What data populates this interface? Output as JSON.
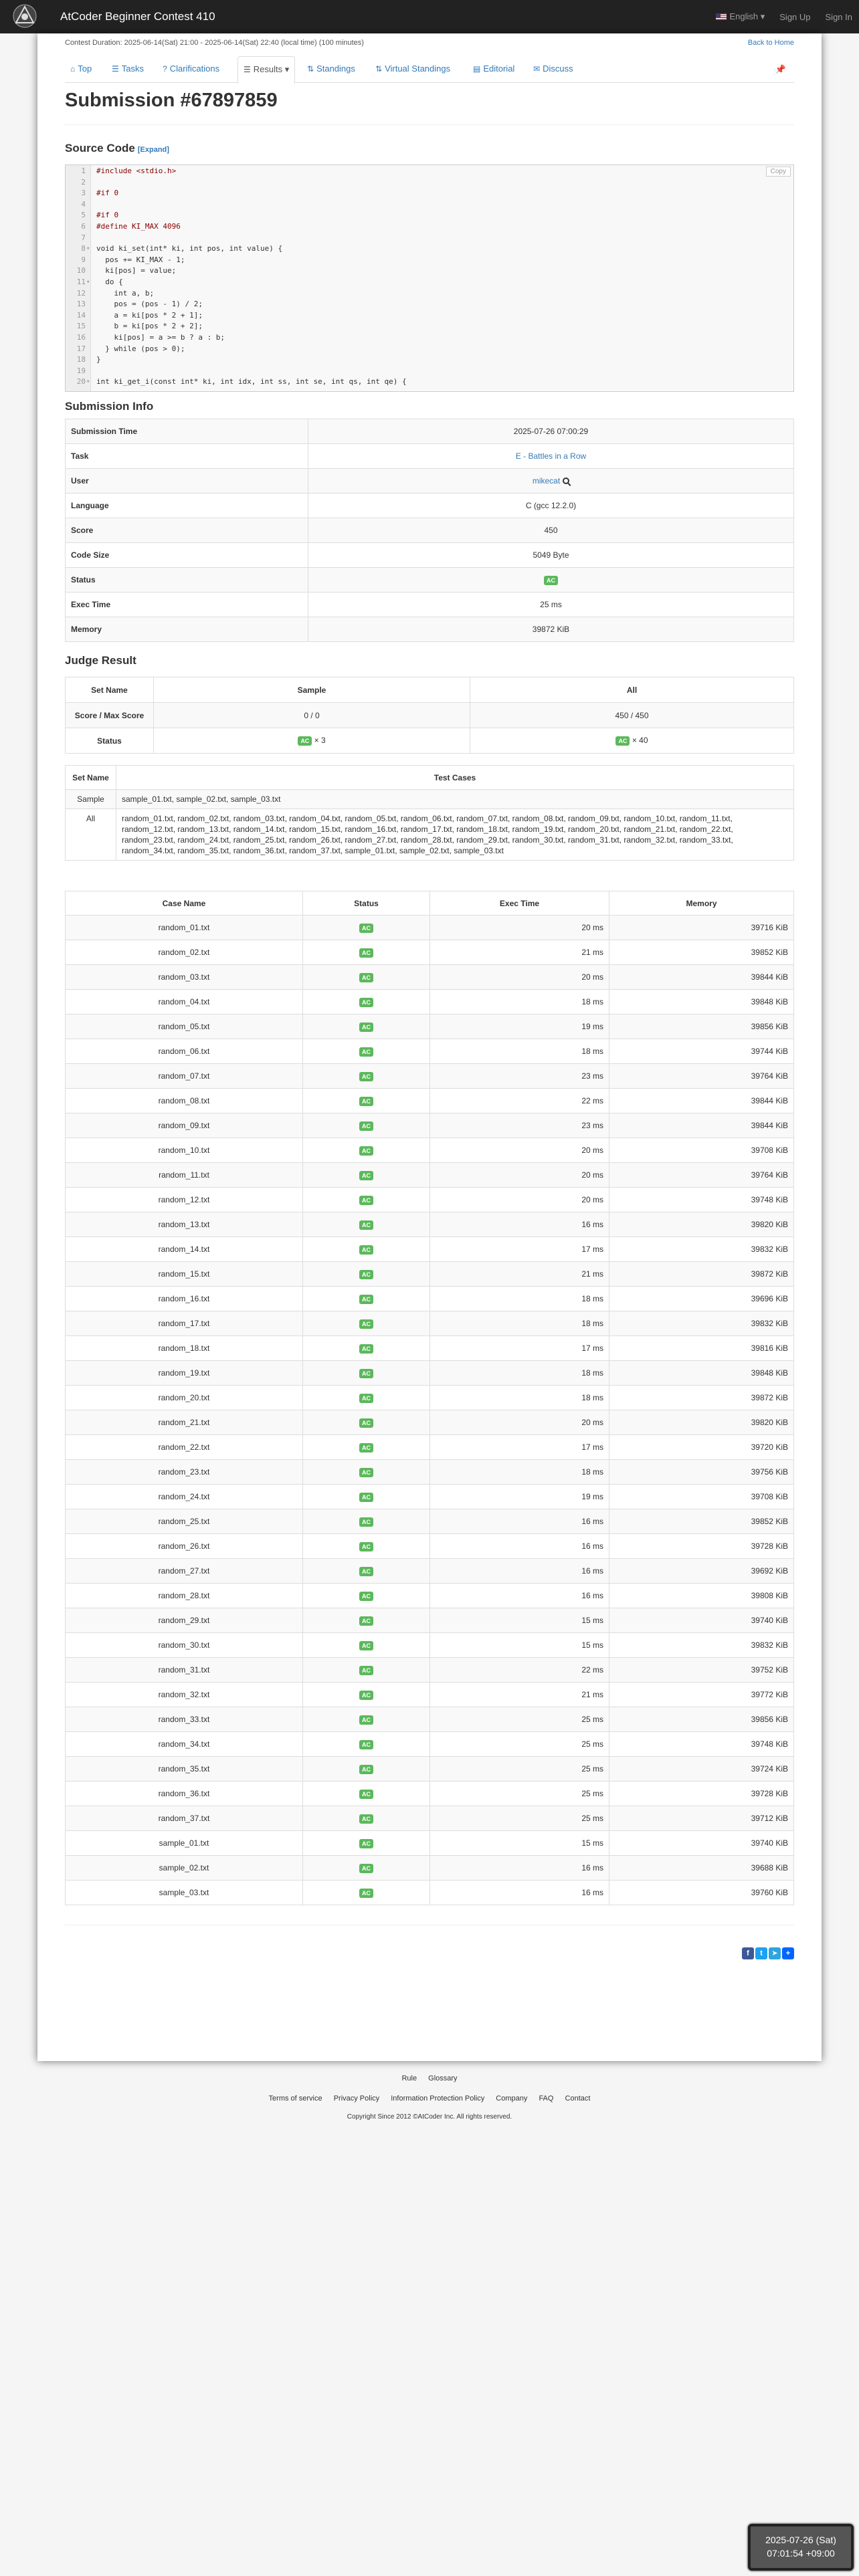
{
  "header": {
    "contest_title": "AtCoder Beginner Contest 410",
    "logo_text": "AtCoder",
    "language": "English",
    "sign_up": "Sign Up",
    "sign_in": "Sign In"
  },
  "contest": {
    "duration": "Contest Duration: 2025-06-14(Sat) 21:00 - 2025-06-14(Sat) 22:40 (local time) (100 minutes)",
    "back_home": "Back to Home"
  },
  "tabs": [
    {
      "label": "Top",
      "icon": "home-icon"
    },
    {
      "label": "Tasks",
      "icon": "list-icon"
    },
    {
      "label": "Clarifications",
      "icon": "question-icon"
    },
    {
      "label": "Results",
      "icon": "list-icon"
    },
    {
      "label": "Standings",
      "icon": "sort-icon"
    },
    {
      "label": "Virtual Standings",
      "icon": "sort-icon"
    },
    {
      "label": "Editorial",
      "icon": "book-icon"
    },
    {
      "label": "Discuss",
      "icon": "comment-icon"
    }
  ],
  "submission": {
    "title": "Submission #67897859",
    "source_heading": "Source Code",
    "expand": "[Expand]",
    "copy": "Copy"
  },
  "code_lines": [
    {
      "n": "1",
      "f": "",
      "t": "#include <stdio.h>"
    },
    {
      "n": "2",
      "f": "",
      "t": ""
    },
    {
      "n": "3",
      "f": "",
      "t": "#if 0"
    },
    {
      "n": "4",
      "f": "",
      "t": ""
    },
    {
      "n": "5",
      "f": "",
      "t": "#if 0"
    },
    {
      "n": "6",
      "f": "",
      "t": "#define KI_MAX 4096"
    },
    {
      "n": "7",
      "f": "",
      "t": ""
    },
    {
      "n": "8",
      "f": "▾",
      "t": "void ki_set(int* ki, int pos, int value) {"
    },
    {
      "n": "9",
      "f": "",
      "t": "  pos += KI_MAX - 1;"
    },
    {
      "n": "10",
      "f": "",
      "t": "  ki[pos] = value;"
    },
    {
      "n": "11",
      "f": "▾",
      "t": "  do {"
    },
    {
      "n": "12",
      "f": "",
      "t": "    int a, b;"
    },
    {
      "n": "13",
      "f": "",
      "t": "    pos = (pos - 1) / 2;"
    },
    {
      "n": "14",
      "f": "",
      "t": "    a = ki[pos * 2 + 1];"
    },
    {
      "n": "15",
      "f": "",
      "t": "    b = ki[pos * 2 + 2];"
    },
    {
      "n": "16",
      "f": "",
      "t": "    ki[pos] = a >= b ? a : b;"
    },
    {
      "n": "17",
      "f": "",
      "t": "  } while (pos > 0);"
    },
    {
      "n": "18",
      "f": "",
      "t": "}"
    },
    {
      "n": "19",
      "f": "",
      "t": ""
    },
    {
      "n": "20",
      "f": "▾",
      "t": "int ki_get_i(const int* ki, int idx, int ss, int se, int qs, int qe) {"
    }
  ],
  "info": {
    "heading": "Submission Info",
    "rows": [
      {
        "label": "Submission Time",
        "value": "2025-07-26 07:00:29"
      },
      {
        "label": "Task",
        "value": "E - Battles in a Row"
      },
      {
        "label": "User",
        "value": "mikecat"
      },
      {
        "label": "Language",
        "value": "C (gcc 12.2.0)"
      },
      {
        "label": "Score",
        "value": "450"
      },
      {
        "label": "Code Size",
        "value": "5049 Byte"
      },
      {
        "label": "Status",
        "value": "AC"
      },
      {
        "label": "Exec Time",
        "value": "25 ms"
      },
      {
        "label": "Memory",
        "value": "39872 KiB"
      }
    ]
  },
  "judge": {
    "heading": "Judge Result",
    "col_set": "Set Name",
    "col_sample": "Sample",
    "col_all": "All",
    "score_label": "Score / Max Score",
    "score_sample": "0 / 0",
    "score_all": "450 / 450",
    "status_label": "Status",
    "status_ac": "AC",
    "sample_count": "× 3",
    "all_count": "× 40"
  },
  "sets": {
    "col_name": "Set Name",
    "col_cases": "Test Cases",
    "rows": [
      {
        "name": "Sample",
        "cases": "sample_01.txt, sample_02.txt, sample_03.txt"
      },
      {
        "name": "All",
        "cases": "random_01.txt, random_02.txt, random_03.txt, random_04.txt, random_05.txt, random_06.txt, random_07.txt, random_08.txt, random_09.txt, random_10.txt, random_11.txt, random_12.txt, random_13.txt, random_14.txt, random_15.txt, random_16.txt, random_17.txt, random_18.txt, random_19.txt, random_20.txt, random_21.txt, random_22.txt, random_23.txt, random_24.txt, random_25.txt, random_26.txt, random_27.txt, random_28.txt, random_29.txt, random_30.txt, random_31.txt, random_32.txt, random_33.txt, random_34.txt, random_35.txt, random_36.txt, random_37.txt, sample_01.txt, sample_02.txt, sample_03.txt"
      }
    ]
  },
  "cases": {
    "headers": [
      "Case Name",
      "Status",
      "Exec Time",
      "Memory"
    ],
    "rows": [
      {
        "name": "random_01.txt",
        "status": "AC",
        "time": "20 ms",
        "mem": "39716 KiB"
      },
      {
        "name": "random_02.txt",
        "status": "AC",
        "time": "21 ms",
        "mem": "39852 KiB"
      },
      {
        "name": "random_03.txt",
        "status": "AC",
        "time": "20 ms",
        "mem": "39844 KiB"
      },
      {
        "name": "random_04.txt",
        "status": "AC",
        "time": "18 ms",
        "mem": "39848 KiB"
      },
      {
        "name": "random_05.txt",
        "status": "AC",
        "time": "19 ms",
        "mem": "39856 KiB"
      },
      {
        "name": "random_06.txt",
        "status": "AC",
        "time": "18 ms",
        "mem": "39744 KiB"
      },
      {
        "name": "random_07.txt",
        "status": "AC",
        "time": "23 ms",
        "mem": "39764 KiB"
      },
      {
        "name": "random_08.txt",
        "status": "AC",
        "time": "22 ms",
        "mem": "39844 KiB"
      },
      {
        "name": "random_09.txt",
        "status": "AC",
        "time": "23 ms",
        "mem": "39844 KiB"
      },
      {
        "name": "random_10.txt",
        "status": "AC",
        "time": "20 ms",
        "mem": "39708 KiB"
      },
      {
        "name": "random_11.txt",
        "status": "AC",
        "time": "20 ms",
        "mem": "39764 KiB"
      },
      {
        "name": "random_12.txt",
        "status": "AC",
        "time": "20 ms",
        "mem": "39748 KiB"
      },
      {
        "name": "random_13.txt",
        "status": "AC",
        "time": "16 ms",
        "mem": "39820 KiB"
      },
      {
        "name": "random_14.txt",
        "status": "AC",
        "time": "17 ms",
        "mem": "39832 KiB"
      },
      {
        "name": "random_15.txt",
        "status": "AC",
        "time": "21 ms",
        "mem": "39872 KiB"
      },
      {
        "name": "random_16.txt",
        "status": "AC",
        "time": "18 ms",
        "mem": "39696 KiB"
      },
      {
        "name": "random_17.txt",
        "status": "AC",
        "time": "18 ms",
        "mem": "39832 KiB"
      },
      {
        "name": "random_18.txt",
        "status": "AC",
        "time": "17 ms",
        "mem": "39816 KiB"
      },
      {
        "name": "random_19.txt",
        "status": "AC",
        "time": "18 ms",
        "mem": "39848 KiB"
      },
      {
        "name": "random_20.txt",
        "status": "AC",
        "time": "18 ms",
        "mem": "39872 KiB"
      },
      {
        "name": "random_21.txt",
        "status": "AC",
        "time": "20 ms",
        "mem": "39820 KiB"
      },
      {
        "name": "random_22.txt",
        "status": "AC",
        "time": "17 ms",
        "mem": "39720 KiB"
      },
      {
        "name": "random_23.txt",
        "status": "AC",
        "time": "18 ms",
        "mem": "39756 KiB"
      },
      {
        "name": "random_24.txt",
        "status": "AC",
        "time": "19 ms",
        "mem": "39708 KiB"
      },
      {
        "name": "random_25.txt",
        "status": "AC",
        "time": "16 ms",
        "mem": "39852 KiB"
      },
      {
        "name": "random_26.txt",
        "status": "AC",
        "time": "16 ms",
        "mem": "39728 KiB"
      },
      {
        "name": "random_27.txt",
        "status": "AC",
        "time": "16 ms",
        "mem": "39692 KiB"
      },
      {
        "name": "random_28.txt",
        "status": "AC",
        "time": "16 ms",
        "mem": "39808 KiB"
      },
      {
        "name": "random_29.txt",
        "status": "AC",
        "time": "15 ms",
        "mem": "39740 KiB"
      },
      {
        "name": "random_30.txt",
        "status": "AC",
        "time": "15 ms",
        "mem": "39832 KiB"
      },
      {
        "name": "random_31.txt",
        "status": "AC",
        "time": "22 ms",
        "mem": "39752 KiB"
      },
      {
        "name": "random_32.txt",
        "status": "AC",
        "time": "21 ms",
        "mem": "39772 KiB"
      },
      {
        "name": "random_33.txt",
        "status": "AC",
        "time": "25 ms",
        "mem": "39856 KiB"
      },
      {
        "name": "random_34.txt",
        "status": "AC",
        "time": "25 ms",
        "mem": "39748 KiB"
      },
      {
        "name": "random_35.txt",
        "status": "AC",
        "time": "25 ms",
        "mem": "39724 KiB"
      },
      {
        "name": "random_36.txt",
        "status": "AC",
        "time": "25 ms",
        "mem": "39728 KiB"
      },
      {
        "name": "random_37.txt",
        "status": "AC",
        "time": "25 ms",
        "mem": "39712 KiB"
      },
      {
        "name": "sample_01.txt",
        "status": "AC",
        "time": "15 ms",
        "mem": "39740 KiB"
      },
      {
        "name": "sample_02.txt",
        "status": "AC",
        "time": "16 ms",
        "mem": "39688 KiB"
      },
      {
        "name": "sample_03.txt",
        "status": "AC",
        "time": "16 ms",
        "mem": "39760 KiB"
      }
    ]
  },
  "footer": {
    "row1": [
      "Rule",
      "Glossary"
    ],
    "row2": [
      "Terms of service",
      "Privacy Policy",
      "Information Protection Policy",
      "Company",
      "FAQ",
      "Contact"
    ],
    "copyright": "Copyright Since 2012 ©AtCoder Inc. All rights reserved."
  },
  "clock": {
    "date": "2025-07-26 (Sat)",
    "time": "07:01:54 +09:00"
  },
  "colors": {
    "ac_green": "#5cb85c",
    "link_blue": "#337ab7",
    "navbar": "#222222"
  }
}
